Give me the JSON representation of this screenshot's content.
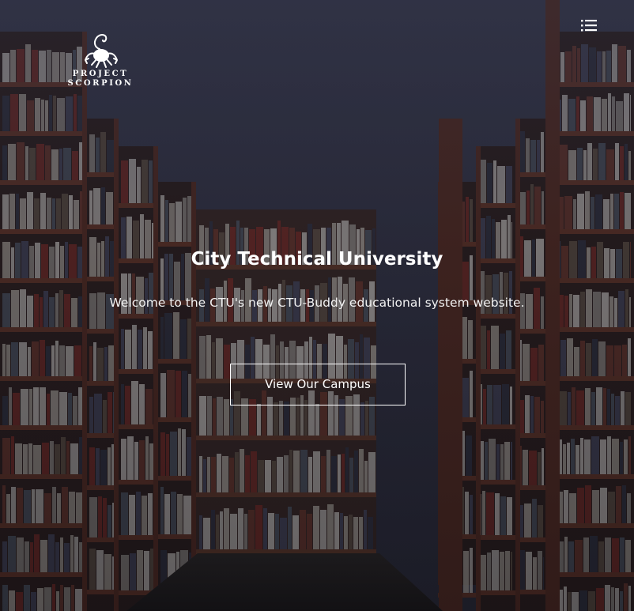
{
  "logo": {
    "line1": "PROJECT",
    "line2": "SCORPION",
    "icon": "scorpion-icon"
  },
  "menu": {
    "icon": "menu-list-icon"
  },
  "hero": {
    "title": "City Technical University",
    "subtitle": "Welcome to the CTU's new CTU-Buddy educational system website.",
    "cta_label": "View Our Campus",
    "background": "library-bookshelves-image"
  },
  "colors": {
    "text": "#ffffff",
    "overlay": "#282a3a",
    "shelf_wood": "#5a2e1e"
  }
}
